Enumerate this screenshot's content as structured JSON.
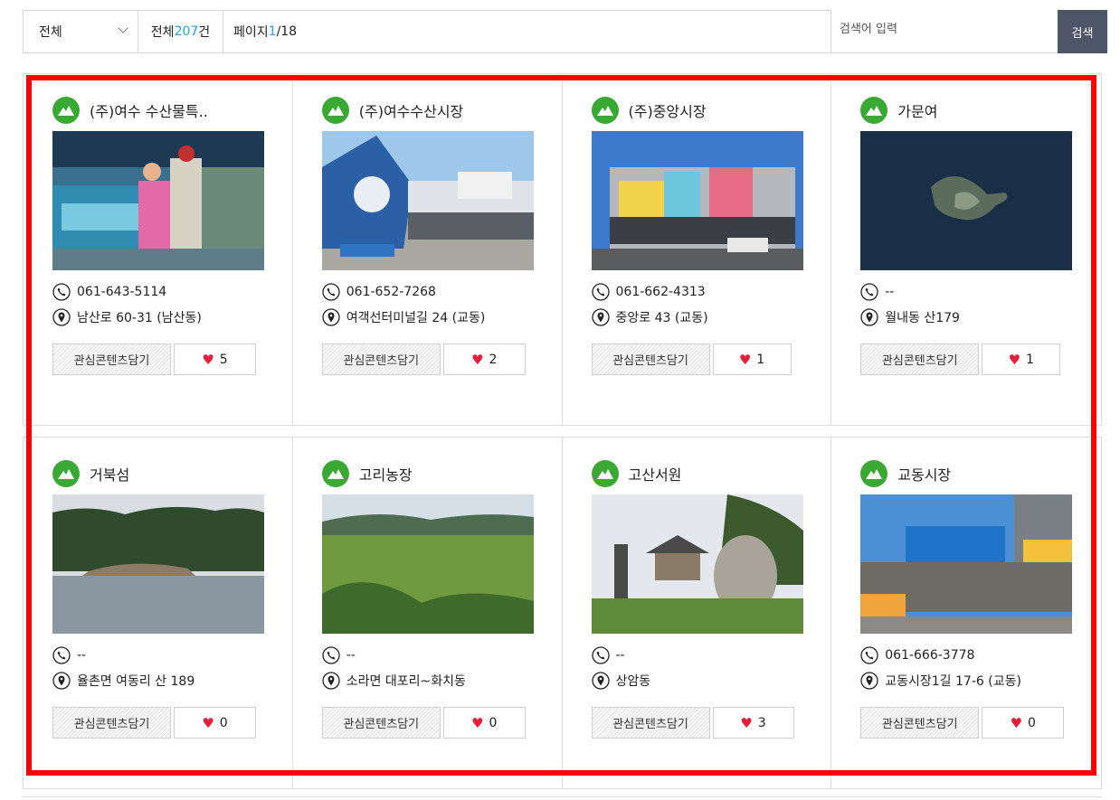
{
  "search": {
    "category": "전체",
    "count_prefix": "전체 ",
    "count_value": "207",
    "count_suffix": "건",
    "page_prefix": "페이지 ",
    "page_current": "1",
    "page_total": "/18",
    "placeholder": "검색어 입력",
    "button_label": "검색"
  },
  "fav_label": "관심콘텐츠담기",
  "items": [
    {
      "title": "(주)여수 수산물특..",
      "phone": "061-643-5114",
      "address": "남산로 60-31 (남산동)",
      "likes": "5"
    },
    {
      "title": "(주)여수수산시장",
      "phone": "061-652-7268",
      "address": "여객선터미널길 24 (교동)",
      "likes": "2"
    },
    {
      "title": "(주)중앙시장",
      "phone": "061-662-4313",
      "address": "중앙로 43 (교동)",
      "likes": "1"
    },
    {
      "title": "가문여",
      "phone": "--",
      "address": "월내동 산179",
      "likes": "1"
    },
    {
      "title": "거북섬",
      "phone": "--",
      "address": "율촌면 여동리 산 189",
      "likes": "0"
    },
    {
      "title": "고리농장",
      "phone": "--",
      "address": "소라면 대포리~화치동",
      "likes": "0"
    },
    {
      "title": "고산서원",
      "phone": "--",
      "address": "상암동",
      "likes": "3"
    },
    {
      "title": "교동시장",
      "phone": "061-666-3778",
      "address": "교동시장1길 17-6 (교동)",
      "likes": "0"
    }
  ],
  "colors": {
    "accent": "#2a9fd8",
    "icon_green": "#3aa934",
    "heart": "#e51e3a",
    "highlight": "#ff0000",
    "search_button": "#4d5566"
  }
}
